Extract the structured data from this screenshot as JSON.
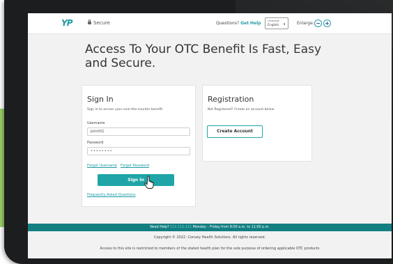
{
  "header": {
    "logo_text": "YP",
    "secure_label": "Secure",
    "questions_label": "Questions?",
    "get_help_label": "Get Help",
    "language_caption": "Language",
    "language_value": "English",
    "enlarge_label": "Enlarge:",
    "zoom_out_symbol": "−",
    "zoom_in_symbol": "+"
  },
  "headline": "Access To Your OTC Benefit Is Fast, Easy and Secure.",
  "signin": {
    "title": "Sign In",
    "description": "Sign in to access your over-the-counter benefit.",
    "username_label": "Username",
    "username_value": "John001",
    "password_label": "Password",
    "password_value": "••••••••",
    "forgot_username": "Forgot Username",
    "forgot_password": "Forgot Password",
    "sign_in_button": "Sign In",
    "faq_link": "Frequently Asked Questions"
  },
  "registration": {
    "title": "Registration",
    "description": "Not Registered? Create an account below",
    "create_button": "Create Account"
  },
  "footer": {
    "help_prefix": "Need Help?",
    "help_phone": "111-111-111",
    "help_hours": "Monday – Friday from 8:00 a.m. to 11:00 p.m.",
    "copyright": "Copyright © 2022. Convey Health Solutions. All rights reserved.",
    "restricted": "Access to this site is restricted to members of the stated health plan for the sole purpose of ordering applicable OTC products"
  },
  "colors": {
    "accent": "#1fa5a7",
    "footer_bar": "#127f82",
    "side_green": "#9ccf6a"
  }
}
